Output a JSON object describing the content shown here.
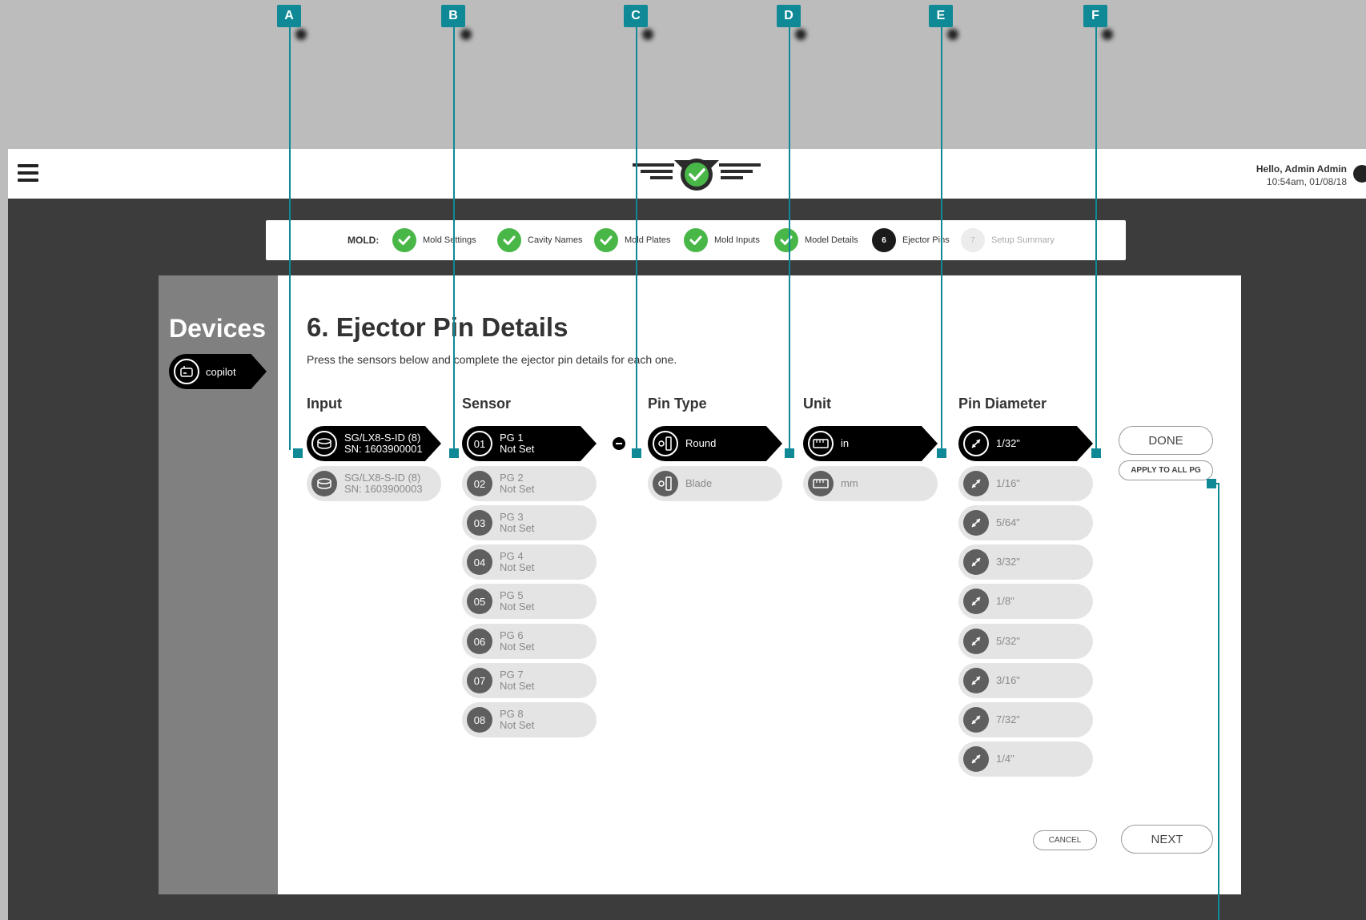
{
  "header": {
    "greeting": "Hello, Admin Admin",
    "datetime": "10:54am, 01/08/18"
  },
  "stepper": {
    "prefix": "MOLD:",
    "steps": [
      {
        "label": "Mold Settings",
        "status": "done"
      },
      {
        "label": "Cavity Names",
        "status": "done"
      },
      {
        "label": "Mold Plates",
        "status": "done"
      },
      {
        "label": "Mold Inputs",
        "status": "done"
      },
      {
        "label": "Model Details",
        "status": "done"
      },
      {
        "label": "Ejector Pins",
        "status": "current",
        "number": "6"
      },
      {
        "label": "Setup Summary",
        "status": "future",
        "number": "7"
      }
    ]
  },
  "sidebar": {
    "title": "Devices",
    "device": "copilot"
  },
  "main": {
    "title": "6. Ejector Pin Details",
    "description": "Press the sensors below and complete the ejector pin details for each one.",
    "columns": {
      "input": "Input",
      "sensor": "Sensor",
      "pin_type": "Pin Type",
      "unit": "Unit",
      "pin_diameter": "Pin Diameter"
    },
    "inputs": [
      {
        "line1": "SG/LX8-S-ID (8)",
        "line2": "SN: 1603900001",
        "selected": true
      },
      {
        "line1": "SG/LX8-S-ID (8)",
        "line2": "SN: 1603900003",
        "selected": false
      }
    ],
    "sensors": [
      {
        "num": "01",
        "name": "PG 1",
        "status": "Not Set",
        "selected": true
      },
      {
        "num": "02",
        "name": "PG 2",
        "status": "Not Set",
        "selected": false
      },
      {
        "num": "03",
        "name": "PG 3",
        "status": "Not Set",
        "selected": false
      },
      {
        "num": "04",
        "name": "PG 4",
        "status": "Not Set",
        "selected": false
      },
      {
        "num": "05",
        "name": "PG 5",
        "status": "Not Set",
        "selected": false
      },
      {
        "num": "06",
        "name": "PG 6",
        "status": "Not Set",
        "selected": false
      },
      {
        "num": "07",
        "name": "PG 7",
        "status": "Not Set",
        "selected": false
      },
      {
        "num": "08",
        "name": "PG 8",
        "status": "Not Set",
        "selected": false
      }
    ],
    "pin_types": [
      {
        "label": "Round",
        "selected": true
      },
      {
        "label": "Blade",
        "selected": false
      }
    ],
    "units": [
      {
        "label": "in",
        "selected": true
      },
      {
        "label": "mm",
        "selected": false
      }
    ],
    "diameters": [
      {
        "label": "1/32\"",
        "selected": true
      },
      {
        "label": "1/16\"",
        "selected": false
      },
      {
        "label": "5/64\"",
        "selected": false
      },
      {
        "label": "3/32\"",
        "selected": false
      },
      {
        "label": "1/8\"",
        "selected": false
      },
      {
        "label": "5/32\"",
        "selected": false
      },
      {
        "label": "3/16\"",
        "selected": false
      },
      {
        "label": "7/32\"",
        "selected": false
      },
      {
        "label": "1/4\"",
        "selected": false
      }
    ],
    "done_label": "DONE",
    "apply_label": "APPLY TO ALL PG",
    "cancel_label": "CANCEL",
    "next_label": "NEXT"
  },
  "callouts": [
    "A",
    "B",
    "C",
    "D",
    "E",
    "F"
  ],
  "colors": {
    "accent": "#0f8996",
    "success": "#49b748",
    "sidebar": "#808080",
    "background": "#3c3c3c"
  }
}
